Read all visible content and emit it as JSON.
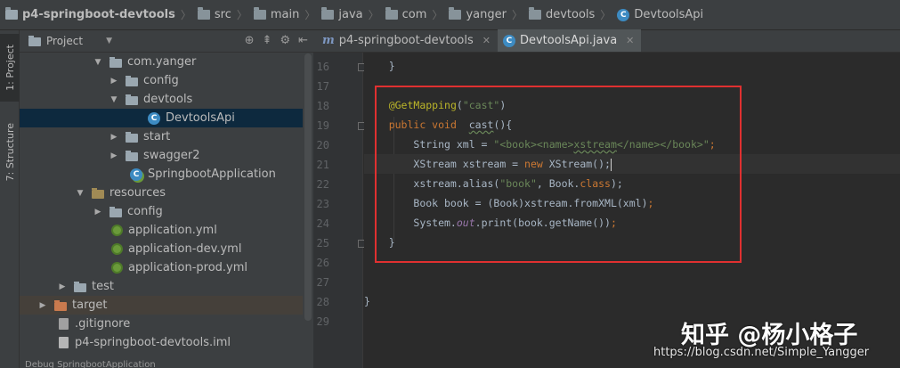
{
  "breadcrumb": {
    "items": [
      "p4-springboot-devtools",
      "src",
      "main",
      "java",
      "com",
      "yanger",
      "devtools",
      "DevtoolsApi"
    ]
  },
  "sidebar": {
    "project_tab": "1: Project",
    "structure_tab": "7: Structure"
  },
  "project_panel": {
    "title": "Project",
    "tree": [
      {
        "label": "com.yanger",
        "icon": "package-folder-icon",
        "expanded": true
      },
      {
        "label": "config",
        "icon": "package-folder-icon",
        "expanded": false
      },
      {
        "label": "devtools",
        "icon": "package-folder-icon",
        "expanded": true
      },
      {
        "label": "DevtoolsApi",
        "icon": "java-class-icon",
        "selected": true
      },
      {
        "label": "start",
        "icon": "package-folder-icon",
        "expanded": false
      },
      {
        "label": "swagger2",
        "icon": "package-folder-icon",
        "expanded": false
      },
      {
        "label": "SpringbootApplication",
        "icon": "spring-boot-class-icon"
      },
      {
        "label": "resources",
        "icon": "resources-folder-icon",
        "expanded": true
      },
      {
        "label": "config",
        "icon": "folder-icon",
        "expanded": false
      },
      {
        "label": "application.yml",
        "icon": "yml-file-icon"
      },
      {
        "label": "application-dev.yml",
        "icon": "yml-file-icon"
      },
      {
        "label": "application-prod.yml",
        "icon": "yml-file-icon"
      },
      {
        "label": "test",
        "icon": "folder-icon",
        "expanded": false
      },
      {
        "label": "target",
        "icon": "excluded-folder-icon",
        "expanded": false
      },
      {
        "label": ".gitignore",
        "icon": "text-file-icon"
      },
      {
        "label": "p4-springboot-devtools.iml",
        "icon": "iml-file-icon"
      }
    ],
    "bottom_text": "Debug   SpringbootApplication"
  },
  "editor": {
    "tabs": [
      {
        "label": "p4-springboot-devtools",
        "icon": "maven-m-icon",
        "active": false
      },
      {
        "label": "DevtoolsApi.java",
        "icon": "java-class-icon",
        "active": true
      }
    ],
    "line_numbers": [
      "16",
      "17",
      "18",
      "19",
      "20",
      "21",
      "22",
      "23",
      "24",
      "25",
      "26",
      "27",
      "28",
      "29"
    ],
    "lines": {
      "l16": "}",
      "l18_annotation": "@GetMapping",
      "l18_arg": "\"cast\"",
      "l19_kw": "public void",
      "l19_name": "cast",
      "l19_rest": "(){",
      "l20_type": "String xml = ",
      "l20_str_a": "\"<book><name>",
      "l20_str_b": "xstream",
      "l20_str_c": "</name></book>\"",
      "l20_end": ";",
      "l21_a": "XStream xstream = ",
      "l21_new": "new",
      "l21_b": " XStream();",
      "l22_a": "xstream.alias(",
      "l22_str": "\"book\"",
      "l22_b": ", Book.",
      "l22_cls": "class",
      "l22_c": ");",
      "l23_a": "Book book = (Book)xstream.fromXML(xml)",
      "l23_end": ";",
      "l24_a": "System.",
      "l24_out": "out",
      "l24_b": ".print(book.getName())",
      "l24_end": ";",
      "l25": "}",
      "l28": "}"
    }
  },
  "watermark": {
    "brand": "知乎 @杨小格子",
    "url": "https://blog.csdn.net/Simple_Yangger"
  },
  "colors": {
    "highlight_border": "#e03030",
    "keyword": "#cc7832",
    "annotation": "#bbb529",
    "string": "#6a8759"
  }
}
